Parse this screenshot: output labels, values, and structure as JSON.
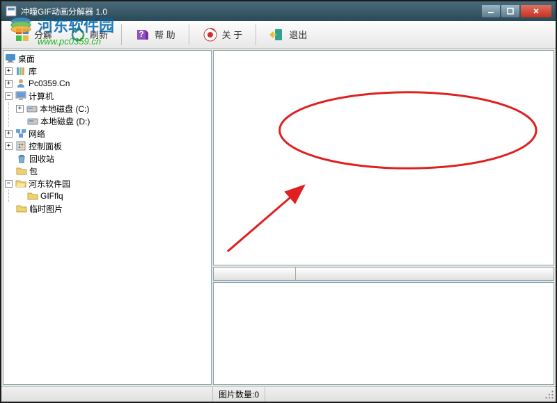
{
  "title": "冲曈GIF动画分解器 1.0",
  "watermark": {
    "brand": "河东软件园",
    "url": "www.pc0359.cn"
  },
  "toolbar": {
    "decompose": "分解",
    "refresh": "刷新",
    "help": "帮 助",
    "about": "关 于",
    "exit": "退出"
  },
  "tree": {
    "desktop": "桌面",
    "library": "库",
    "pc0359": "Pc0359.Cn",
    "computer": "计算机",
    "diskC": "本地磁盘 (C:)",
    "diskD": "本地磁盘 (D:)",
    "network": "网络",
    "controlPanel": "控制面板",
    "recycleBin": "回收站",
    "package": "包",
    "hedong": "河东软件园",
    "gifflq": "GIFflq",
    "tempImages": "临时图片"
  },
  "status": {
    "imageCount": "图片数量:0"
  }
}
